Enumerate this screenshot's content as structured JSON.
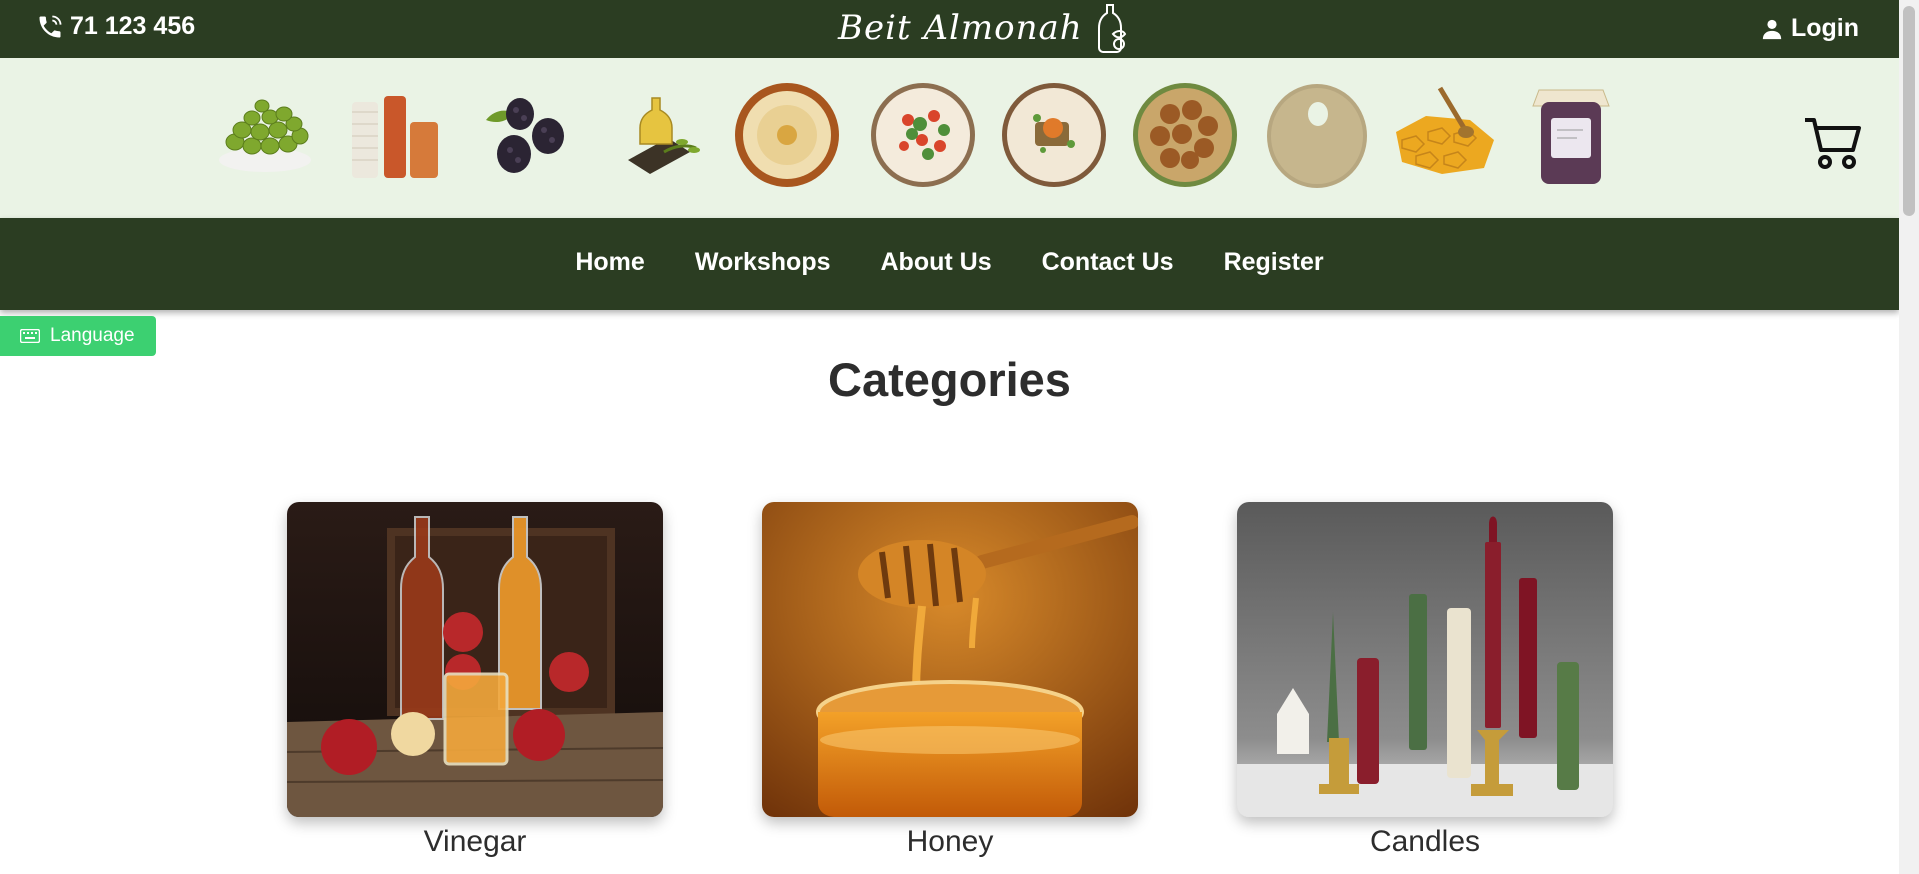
{
  "topbar": {
    "phone": "71 123 456",
    "brand": "Beit Almonah",
    "login": "Login"
  },
  "icons": {
    "phone": "phone-icon",
    "user": "user-icon",
    "cart": "cart-icon",
    "language": "keyboard-icon"
  },
  "products": [
    "olives",
    "thread-spools",
    "blackberries",
    "olive-oil",
    "hummus",
    "salad",
    "kebbeh",
    "falafel",
    "bread-ring",
    "honeycomb",
    "jam-jar"
  ],
  "nav": {
    "items": [
      "Home",
      "Workshops",
      "About Us",
      "Contact Us",
      "Register"
    ]
  },
  "language": {
    "label": "Language"
  },
  "categories": {
    "title": "Categories",
    "items": [
      {
        "name": "Vinegar"
      },
      {
        "name": "Honey"
      },
      {
        "name": "Candles"
      }
    ]
  },
  "colors": {
    "header": "#2b3d22",
    "strip": "#eaf3e5",
    "language_button": "#3cd071"
  }
}
